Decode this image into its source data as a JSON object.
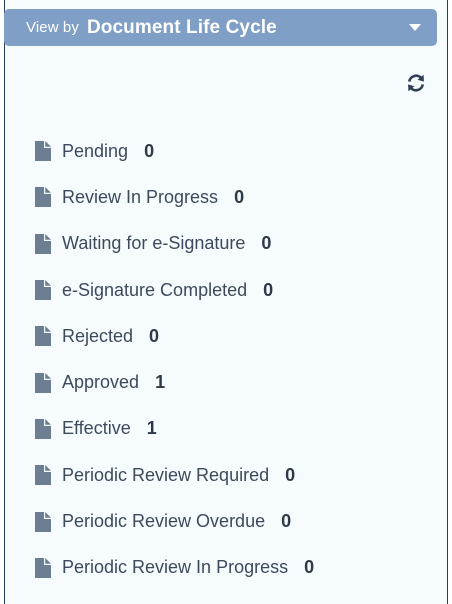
{
  "header": {
    "prefix": "View by",
    "title": "Document Life Cycle"
  },
  "icons": {
    "refresh": "refresh-icon",
    "item": "document-icon",
    "dropdown": "chevron-down-icon"
  },
  "colors": {
    "header_bg": "#7f9fc6",
    "icon": "#6e7e92",
    "refresh_icon": "#2f3e55"
  },
  "items": [
    {
      "label": "Pending",
      "count": "0"
    },
    {
      "label": "Review In Progress",
      "count": "0"
    },
    {
      "label": "Waiting for e-Signature",
      "count": "0"
    },
    {
      "label": "e-Signature Completed",
      "count": "0"
    },
    {
      "label": "Rejected",
      "count": "0"
    },
    {
      "label": "Approved",
      "count": "1"
    },
    {
      "label": "Effective",
      "count": "1"
    },
    {
      "label": "Periodic Review Required",
      "count": "0"
    },
    {
      "label": "Periodic Review Overdue",
      "count": "0"
    },
    {
      "label": "Periodic Review In Progress",
      "count": "0"
    }
  ]
}
